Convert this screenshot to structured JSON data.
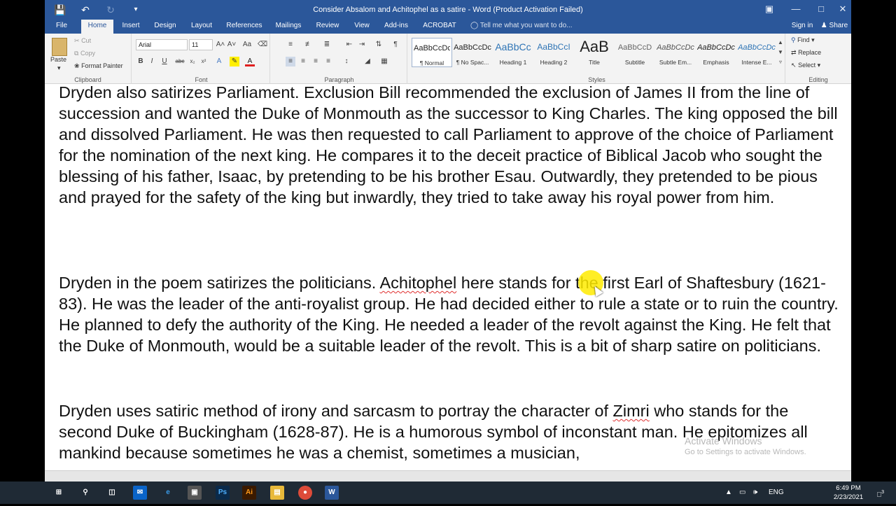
{
  "window": {
    "title": "Consider Absalom and Achitophel as a satire - Word (Product Activation Failed)",
    "sign_in": "Sign in",
    "share": "Share"
  },
  "tabs": [
    "File",
    "Home",
    "Insert",
    "Design",
    "Layout",
    "References",
    "Mailings",
    "Review",
    "View",
    "Add-ins",
    "ACROBAT"
  ],
  "tell_me": "Tell me what you want to do...",
  "ribbon": {
    "clipboard": {
      "label": "Clipboard",
      "paste": "Paste",
      "cut": "Cut",
      "copy": "Copy",
      "format_painter": "Format Painter"
    },
    "font": {
      "label": "Font",
      "family": "Arial",
      "size": "11"
    },
    "paragraph": {
      "label": "Paragraph"
    },
    "styles": {
      "label": "Styles",
      "items": [
        {
          "sample": "AaBbCcDc",
          "name": "¶ Normal"
        },
        {
          "sample": "AaBbCcDc",
          "name": "¶ No Spac..."
        },
        {
          "sample": "AaBbCc",
          "name": "Heading 1"
        },
        {
          "sample": "AaBbCcI",
          "name": "Heading 2"
        },
        {
          "sample": "AaB",
          "name": "Title"
        },
        {
          "sample": "AaBbCcD",
          "name": "Subtitle"
        },
        {
          "sample": "AaBbCcDc",
          "name": "Subtle Em..."
        },
        {
          "sample": "AaBbCcDc",
          "name": "Emphasis"
        },
        {
          "sample": "AaBbCcDc",
          "name": "Intense E..."
        }
      ]
    },
    "editing": {
      "label": "Editing",
      "find": "Find",
      "replace": "Replace",
      "select": "Select"
    }
  },
  "document": {
    "p1": "Dryden also satirizes Parliament. Exclusion Bill recommended the exclusion of James II from the line of succession and wanted the Duke of Monmouth as the successor to King Charles. The king opposed the bill and dissolved Parliament. He was then requested to call Parliament to approve of the choice of Parliament for the nomination of the next king. He compares it to the deceit practice of Biblical Jacob who sought the blessing of his father, Isaac, by pretending to be his brother Esau. Outwardly, they pretended to be pious and prayed for the safety of the king but inwardly, they tried to take away his royal power from him.",
    "p2a": "Dryden in the poem satirizes the politicians. ",
    "p2b": "Achitophel",
    "p2c": " here stands for the first Earl of Shaftesbury (1621-83). He was the leader of the anti-royalist group. He had decided either to rule a state or to ruin the country. He planned to defy the authority of the King. He needed a leader of the revolt against the King. He felt that the Duke of Monmouth, would be a suitable leader of the revolt. This is a bit of sharp satire on politicians.",
    "p3a": "Dryden uses satiric method of irony and sarcasm to portray the character of ",
    "p3b": "Zimri",
    "p3c": " who stands for the second Duke of Buckingham (1628-87). He is a humorous symbol of inconstant man. He epitomizes all mankind because sometimes he was a chemist, sometimes a musician,"
  },
  "watermark": {
    "line1": "Activate Windows",
    "line2": "Go to Settings to activate Windows."
  },
  "taskbar": {
    "lang": "ENG",
    "time": "6:49 PM",
    "date": "2/23/2021",
    "notifications": "3"
  }
}
